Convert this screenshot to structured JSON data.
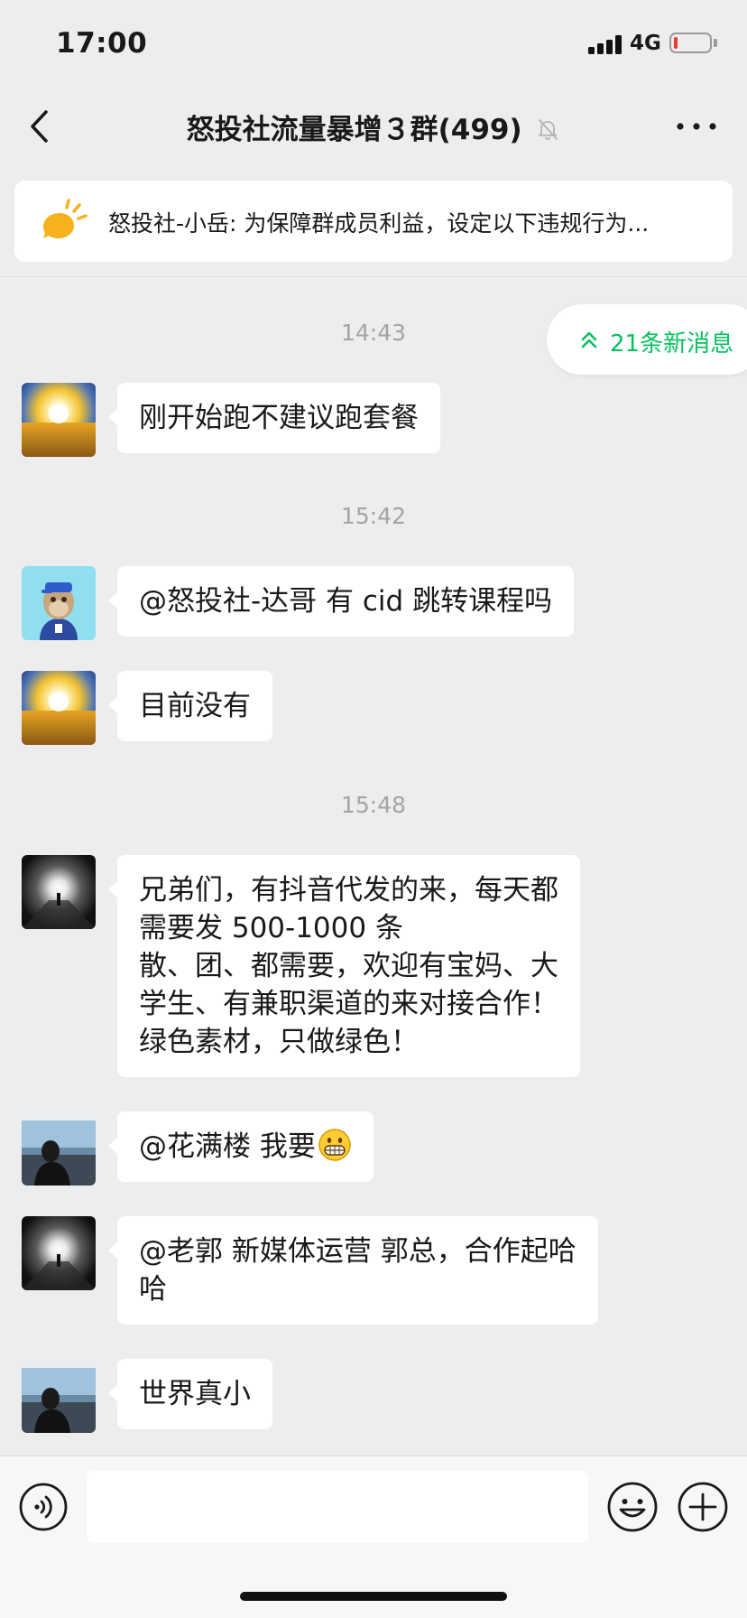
{
  "status_bar": {
    "time": "17:00",
    "network": "4G",
    "battery_percent": 10
  },
  "header": {
    "title": "怒投社流量暴增３群(499)"
  },
  "notice": {
    "text": "怒投社-小岳: 为保障群成员利益，设定以下违规行为..."
  },
  "new_messages": {
    "label": "21条新消息"
  },
  "chat": {
    "timestamps": [
      "14:43",
      "15:42",
      "15:48"
    ],
    "messages": [
      {
        "lines": [
          "刚开始跑不建议跑套餐"
        ]
      },
      {
        "lines": [
          "@怒投社-达哥 有 cid 跳转课程吗"
        ]
      },
      {
        "lines": [
          "目前没有"
        ]
      },
      {
        "lines": [
          "兄弟们，有抖音代发的来，每天都",
          "需要发 500-1000 条",
          "散、团、都需要，欢迎有宝妈、大",
          "学生、有兼职渠道的来对接合作！",
          "绿色素材，只做绿色！"
        ]
      },
      {
        "lines": [
          "@花满楼 我要"
        ]
      },
      {
        "lines": [
          "@老郭 新媒体运营 郭总，合作起哈",
          "哈"
        ]
      },
      {
        "lines": [
          "世界真小"
        ]
      }
    ]
  },
  "input_bar": {
    "placeholder": ""
  },
  "colors": {
    "accent": "#07c160",
    "background": "#ededed",
    "bubble": "#ffffff",
    "battery_low": "#ea3b2f"
  }
}
